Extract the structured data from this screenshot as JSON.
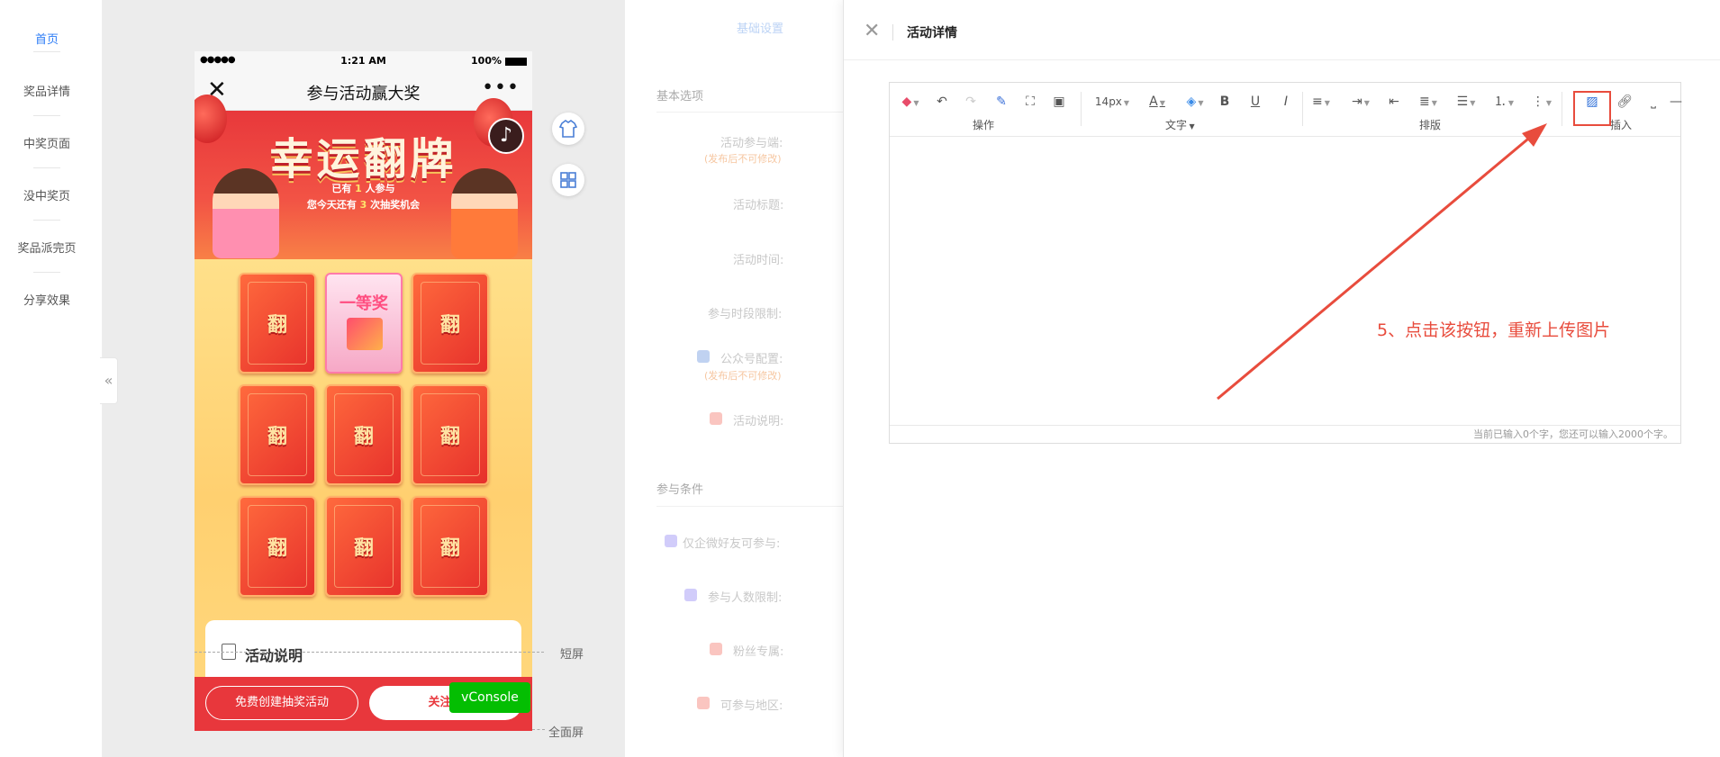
{
  "leftnav": {
    "items": [
      {
        "label": "首页",
        "active": true
      },
      {
        "label": "奖品详情"
      },
      {
        "label": "中奖页面"
      },
      {
        "label": "没中奖页"
      },
      {
        "label": "奖品派完页"
      },
      {
        "label": "分享效果"
      }
    ],
    "collapse_icon": "«"
  },
  "phone": {
    "status": {
      "signal": "●●●●●",
      "time": "1:21 AM",
      "battery": "100%"
    },
    "titlebar": {
      "close": "✕",
      "title": "参与活动赢大奖",
      "more": "•••"
    },
    "banner": {
      "title": "幸运翻牌",
      "line1_pre": "已有",
      "line1_num": "1",
      "line1_post": "人参与",
      "line2_pre": "您今天还有",
      "line2_num": "3",
      "line2_post": "次抽奖机会"
    },
    "music_icon": "♪",
    "cards": [
      "翻",
      "一等奖",
      "翻",
      "翻",
      "翻",
      "翻",
      "翻",
      "翻",
      "翻"
    ],
    "info": {
      "title": "活动说明"
    },
    "bottom": {
      "create": "免费创建抽奖活动",
      "follow": "关注我"
    }
  },
  "vconsole": "vConsole",
  "guides": {
    "short": "短屏",
    "full": "全面屏"
  },
  "mid": {
    "top_tab": "基础设置",
    "section1": "基本选项",
    "fields": [
      {
        "label": "活动参与端:",
        "warn": "(发布后不可修改)"
      },
      {
        "label": "活动标题:"
      },
      {
        "label": "活动时间:"
      },
      {
        "label": "参与时段限制:"
      },
      {
        "label": "公众号配置:",
        "warn": "(发布后不可修改)"
      },
      {
        "label": "活动说明:"
      }
    ],
    "section2": "参与条件",
    "fields2": [
      {
        "label": "仅企微好友可参与:"
      },
      {
        "label": "参与人数限制:"
      },
      {
        "label": "粉丝专属:"
      },
      {
        "label": "可参与地区:"
      }
    ]
  },
  "panel": {
    "close": "✕",
    "title": "活动详情",
    "toolbar": {
      "font_size": "14px",
      "groups": [
        "操作",
        "文字",
        "排版",
        "插入"
      ]
    },
    "status": "当前已输入0个字，您还可以输入2000个字。"
  },
  "annotation": {
    "text": "5、点击该按钮，重新上传图片",
    "color": "#e84c3d"
  }
}
